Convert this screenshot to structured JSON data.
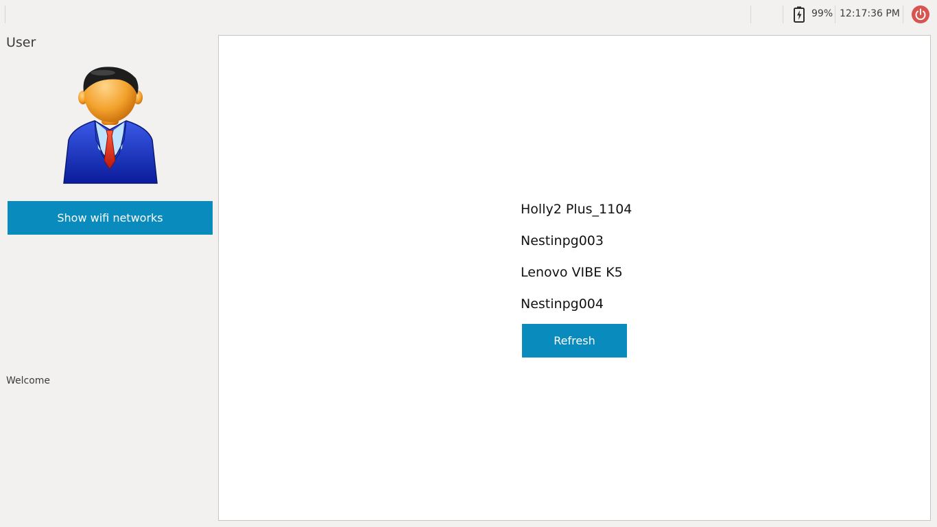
{
  "topbar": {
    "battery_icon": "battery-charging-icon",
    "battery_percent": "99%",
    "time": "12:17:36 PM",
    "power_icon": "power-icon",
    "power_color": "#d9534f"
  },
  "sidebar": {
    "title": "User",
    "avatar_icon": "businessman-avatar",
    "wifi_button_label": "Show wifi networks",
    "welcome_text": "Welcome",
    "accent_color": "#0a8bbd"
  },
  "main": {
    "networks": [
      "Holly2 Plus_1104",
      "Nestinpg003",
      "Lenovo VIBE K5",
      "Nestinpg004"
    ],
    "refresh_label": "Refresh"
  }
}
